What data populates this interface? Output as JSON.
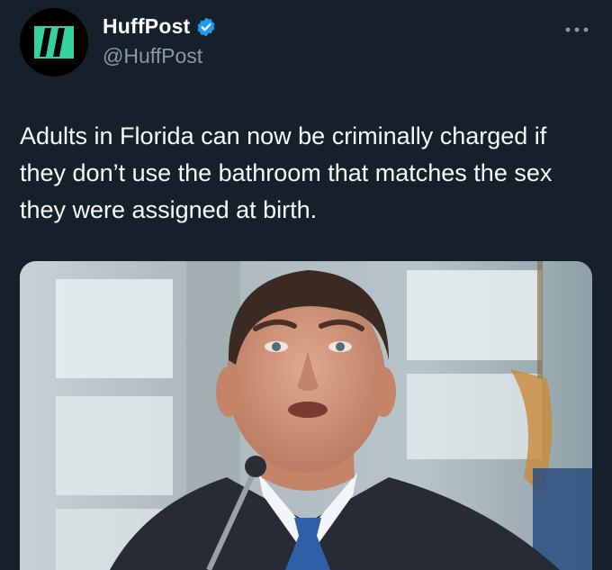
{
  "account": {
    "display_name": "HuffPost",
    "handle": "@HuffPost",
    "verified": true,
    "verified_icon": "verified-badge-icon",
    "avatar_icon": "huffpost-logo-icon"
  },
  "menu": {
    "icon": "more-options-icon"
  },
  "tweet": {
    "text": "Adults in Florida can now be criminally charged if they don’t use the bathroom that matches the sex they were assigned at birth."
  },
  "media": {
    "type": "photo"
  },
  "colors": {
    "background": "#15202b",
    "handle": "#8b98a5",
    "verified": "#1d9bf0",
    "logo_green": "#35d29f"
  }
}
